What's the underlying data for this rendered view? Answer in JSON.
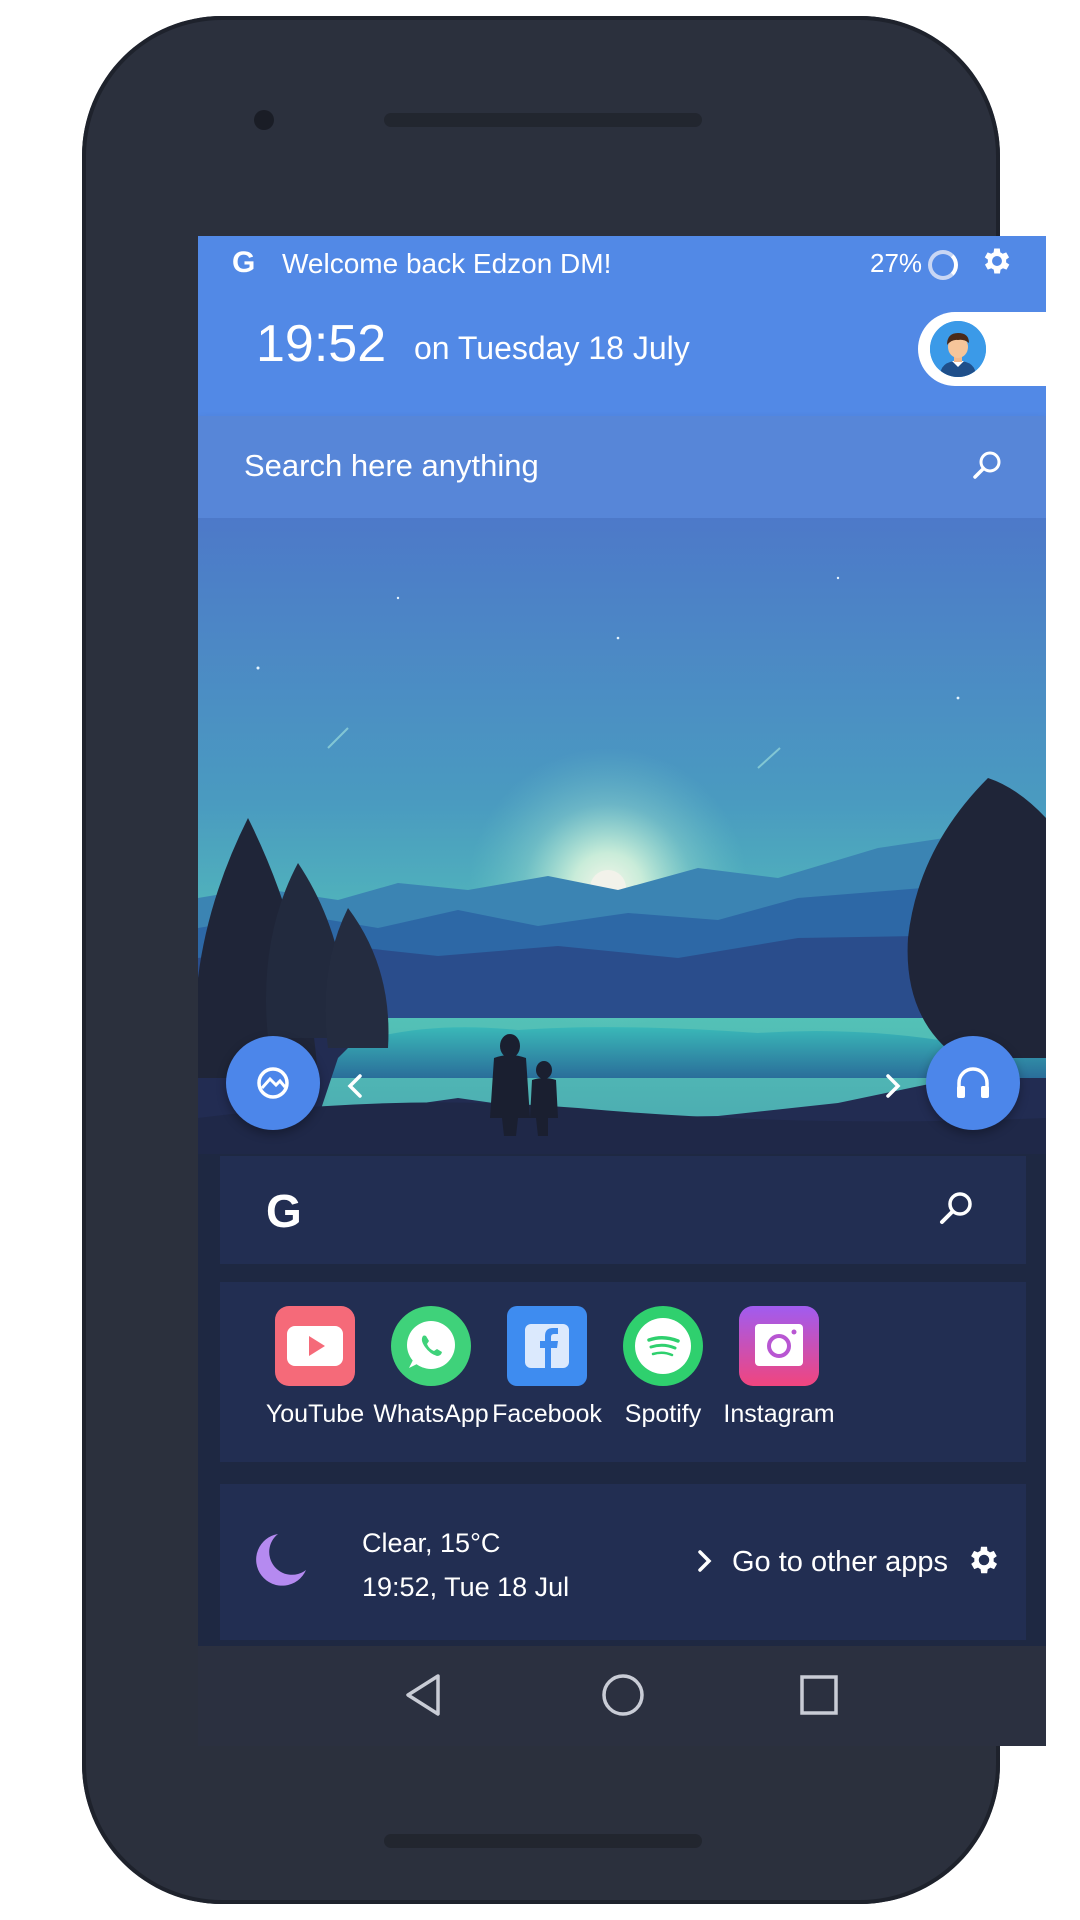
{
  "status": {
    "google_letter": "G",
    "welcome": "Welcome back Edzon DM!",
    "battery": "27%"
  },
  "clock": {
    "time": "19:52",
    "date": "on Tuesday 18 July"
  },
  "search": {
    "placeholder": "Search here anything"
  },
  "google_bar": {
    "letter": "G"
  },
  "apps": [
    {
      "label": "YouTube",
      "color": "#f36b7a"
    },
    {
      "label": "WhatsApp",
      "color": "#3fd27a"
    },
    {
      "label": "Facebook",
      "color": "#3e8cf0"
    },
    {
      "label": "Spotify",
      "color": "#2fd06e"
    },
    {
      "label": "Instagram",
      "color": "#c041d6"
    }
  ],
  "weather": {
    "condition": "Clear, 15°C",
    "datetime": "19:52, Tue 18 Jul",
    "go_to_apps": "Go to other apps"
  },
  "colors": {
    "header_blue": "#5289e6",
    "fab_blue": "#4c86ea",
    "panel": "#222e52",
    "moon": "#b58af0"
  }
}
